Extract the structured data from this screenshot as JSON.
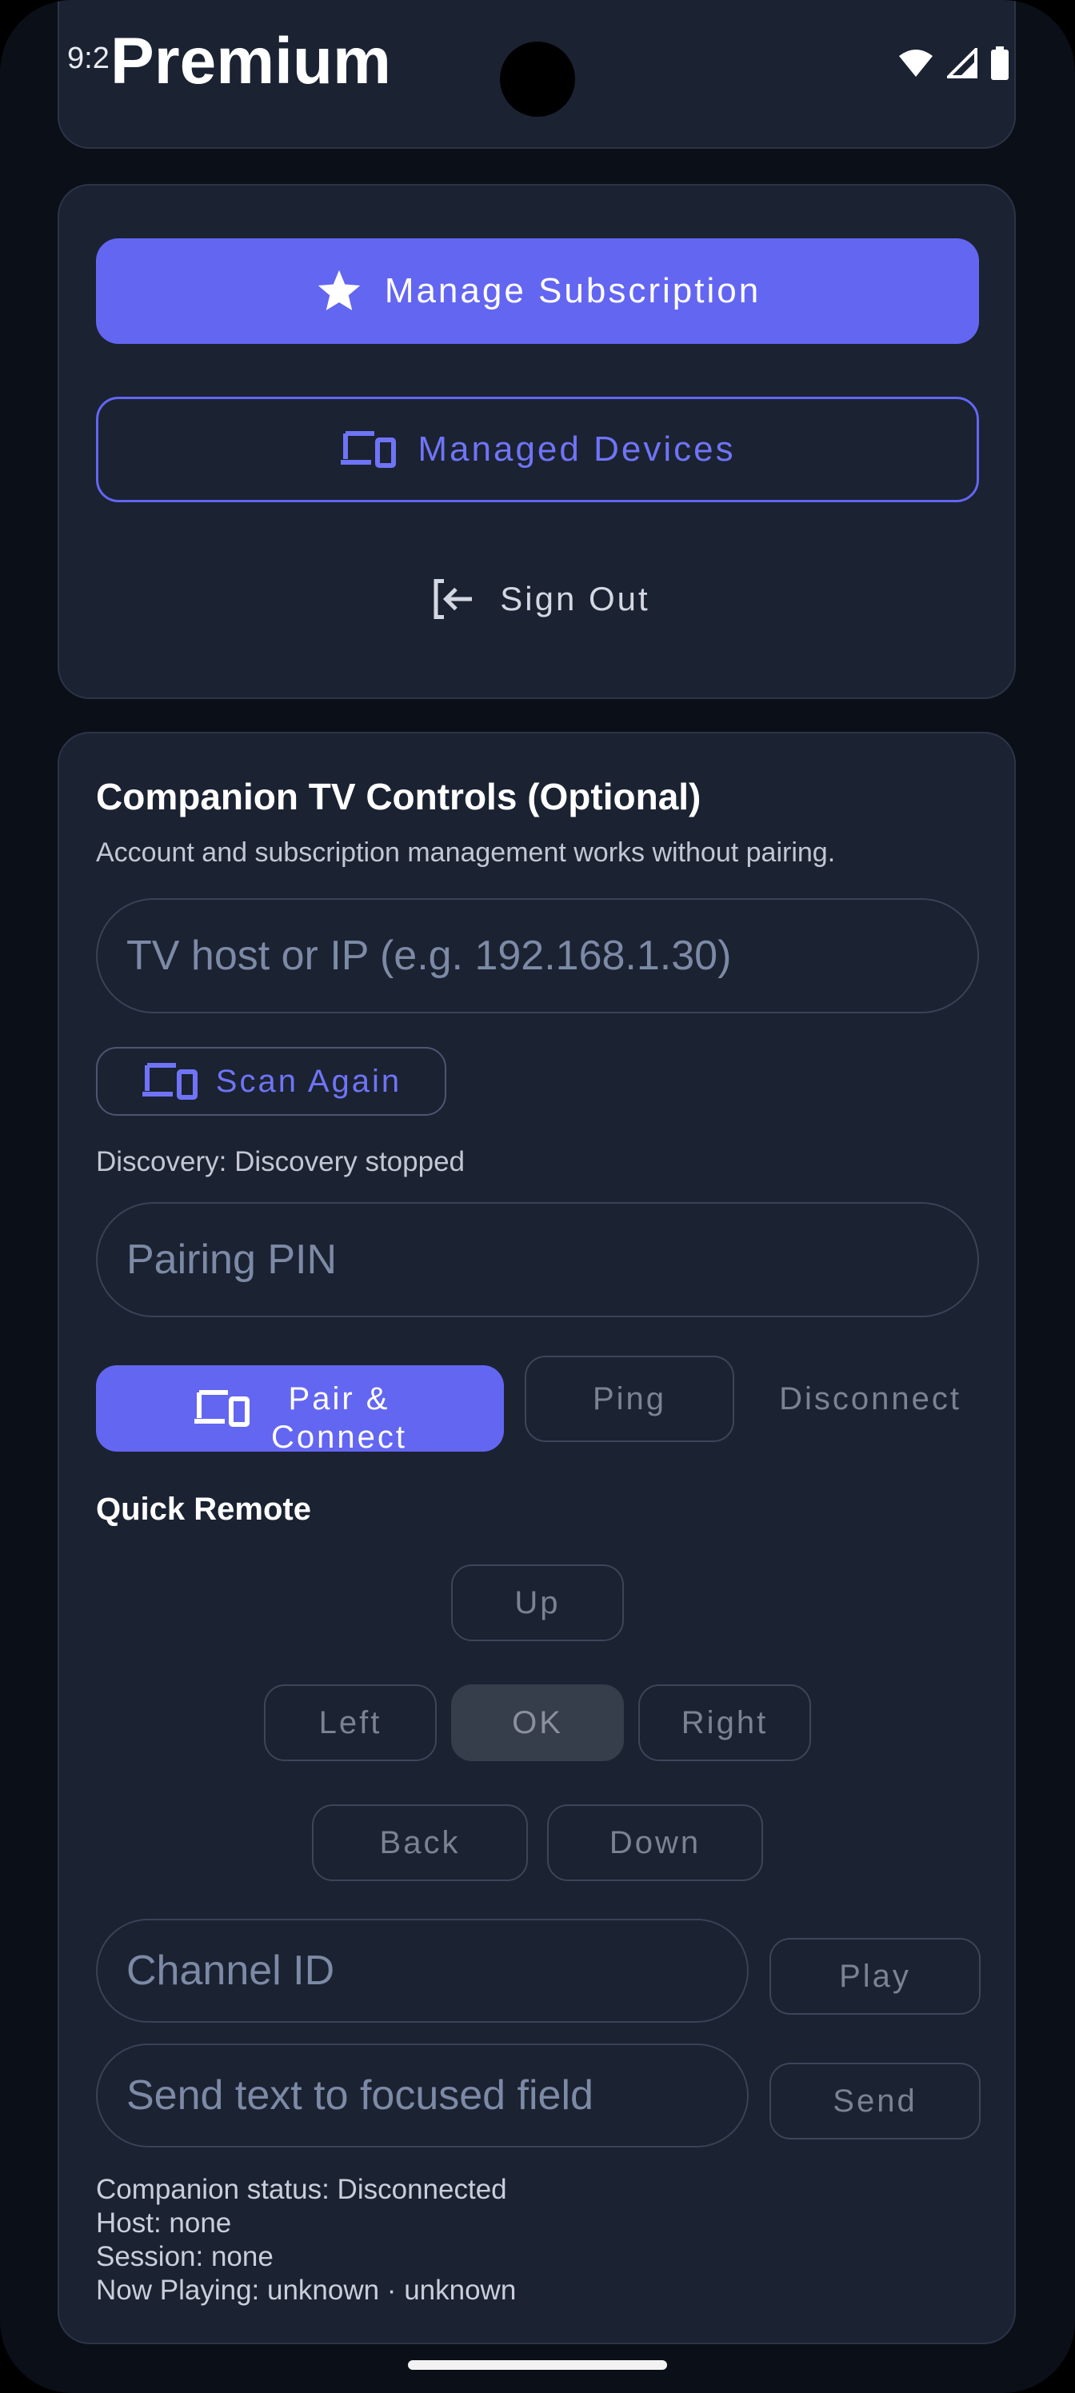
{
  "status_bar": {
    "time": "9:2",
    "page_title": "Premium"
  },
  "account_actions": {
    "manage_subscription": "Manage Subscription",
    "managed_devices": "Managed Devices",
    "sign_out": "Sign Out"
  },
  "companion": {
    "title": "Companion TV Controls (Optional)",
    "subtitle": "Account and subscription management works without pairing.",
    "host_placeholder": "TV host or IP (e.g. 192.168.1.30)",
    "scan_again": "Scan Again",
    "discovery_status": "Discovery: Discovery stopped",
    "pin_placeholder": "Pairing PIN",
    "pair_connect": "Pair &\nConnect",
    "ping": "Ping",
    "disconnect": "Disconnect"
  },
  "quick_remote": {
    "title": "Quick Remote",
    "up": "Up",
    "left": "Left",
    "ok": "OK",
    "right": "Right",
    "back": "Back",
    "down": "Down",
    "channel_placeholder": "Channel ID",
    "play": "Play",
    "text_placeholder": "Send text to focused field",
    "send": "Send"
  },
  "status_info": {
    "companion_status": "Companion status: Disconnected",
    "host": "Host: none",
    "session": "Session: none",
    "now_playing": "Now Playing: unknown · unknown"
  },
  "colors": {
    "accent": "#6366f1",
    "card": "#1b2232",
    "background": "#0b0f18"
  }
}
